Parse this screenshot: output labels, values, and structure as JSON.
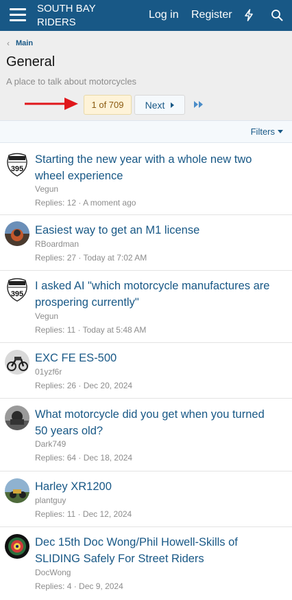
{
  "header": {
    "site_name": "SOUTH BAY RIDERS",
    "login_label": "Log in",
    "register_label": "Register",
    "brand_color": "#185886"
  },
  "page": {
    "breadcrumb": "Main",
    "title": "General",
    "description": "A place to talk about motorcycles"
  },
  "pagination": {
    "current": "1 of 709",
    "next_label": "Next"
  },
  "filters_label": "Filters",
  "threads": [
    {
      "title": "Starting the new year with a whole new two wheel experience",
      "author": "Vegun",
      "replies": "Replies: 12",
      "time": "A moment ago"
    },
    {
      "title": "Easiest way to get an M1 license",
      "author": "RBoardman",
      "replies": "Replies: 27",
      "time": "Today at 7:02 AM"
    },
    {
      "title": "I asked AI \"which motorcycle manufactures are prospering currently\"",
      "author": "Vegun",
      "replies": "Replies: 11",
      "time": "Today at 5:48 AM"
    },
    {
      "title": "EXC FE ES-500",
      "author": "01yzf6r",
      "replies": "Replies: 26",
      "time": "Dec 20, 2024"
    },
    {
      "title": "What motorcycle did you get when you turned 50 years old?",
      "author": "Dark749",
      "replies": "Replies: 64",
      "time": "Dec 18, 2024"
    },
    {
      "title": "Harley XR1200",
      "author": "plantguy",
      "replies": "Replies: 11",
      "time": "Dec 12, 2024"
    },
    {
      "title": "Dec 15th Doc Wong/Phil Howell-Skills of SLIDING Safely For Street Riders",
      "author": "DocWong",
      "replies": "Replies: 4",
      "time": "Dec 9, 2024"
    }
  ],
  "shield_text": "395"
}
